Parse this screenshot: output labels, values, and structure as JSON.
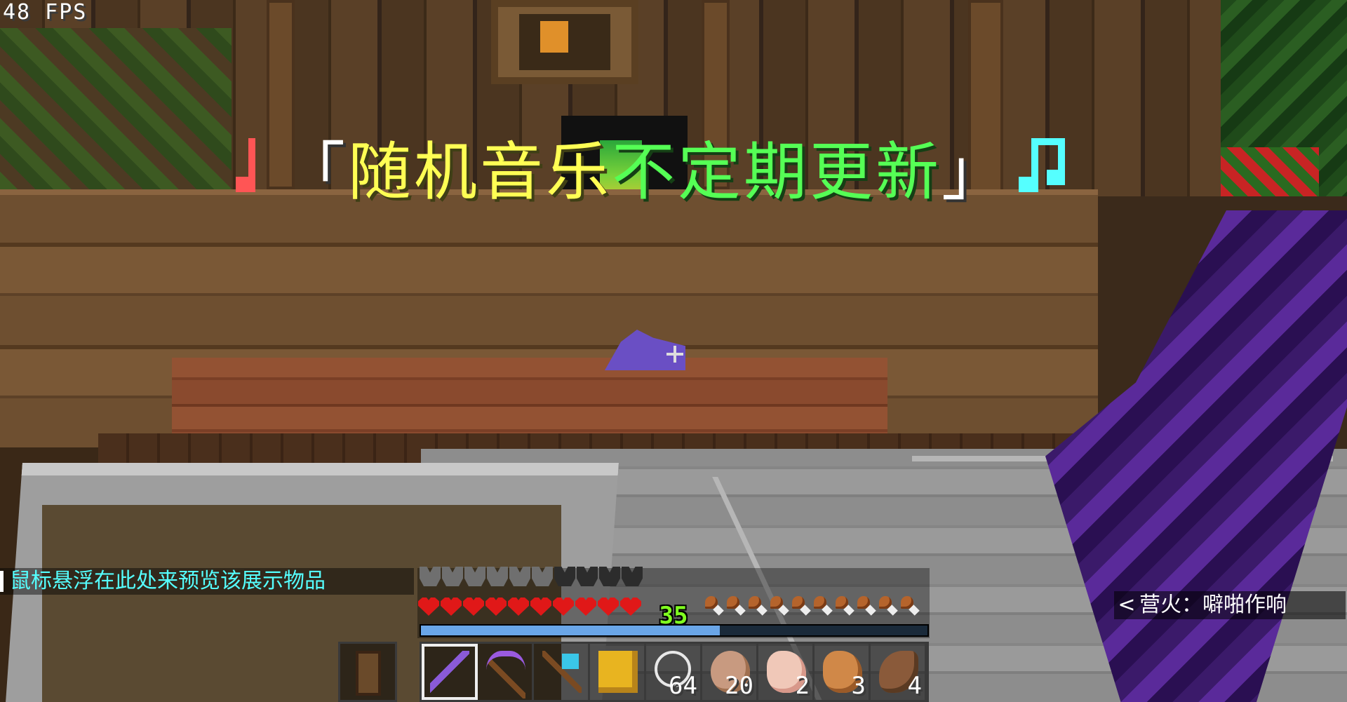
{
  "fps_counter": "48 FPS",
  "music_banner": {
    "open_bracket": "「",
    "text_yellow": "随机音乐",
    "text_green": "不定期更新",
    "close_bracket": "」"
  },
  "hover_tip": "鼠标悬浮在此处来预览该展示物品",
  "subtitle": {
    "arrow": "<",
    "text": "营火：噼啪作响"
  },
  "status": {
    "armor_points_filled": 6,
    "armor_slots": 10,
    "hearts_filled": 10,
    "hunger_filled": 10,
    "xp_level": "35",
    "xp_progress": 0.59
  },
  "offhand": {
    "icon": "door-icon"
  },
  "hotbar": {
    "selected_index": 0,
    "slots": [
      {
        "icon": "netherite-sword-icon",
        "count": ""
      },
      {
        "icon": "enchanted-pickaxe-icon",
        "count": ""
      },
      {
        "icon": "diamond-axe-icon",
        "count": ""
      },
      {
        "icon": "gold-block-icon",
        "count": ""
      },
      {
        "icon": "string-icon",
        "count": "64"
      },
      {
        "icon": "cooked-mutton-icon",
        "count": "20"
      },
      {
        "icon": "raw-chicken-icon",
        "count": "2"
      },
      {
        "icon": "cooked-chicken-icon",
        "count": "3"
      },
      {
        "icon": "steak-icon",
        "count": "4"
      }
    ]
  },
  "colors": {
    "note_left": "#ff5555",
    "note_right": "#55ffff",
    "banner_yellow": "#ffff54",
    "banner_green": "#55ff55",
    "hover_tip": "#55ffff",
    "heart": "#e01818",
    "xp_level": "#80ff20"
  }
}
